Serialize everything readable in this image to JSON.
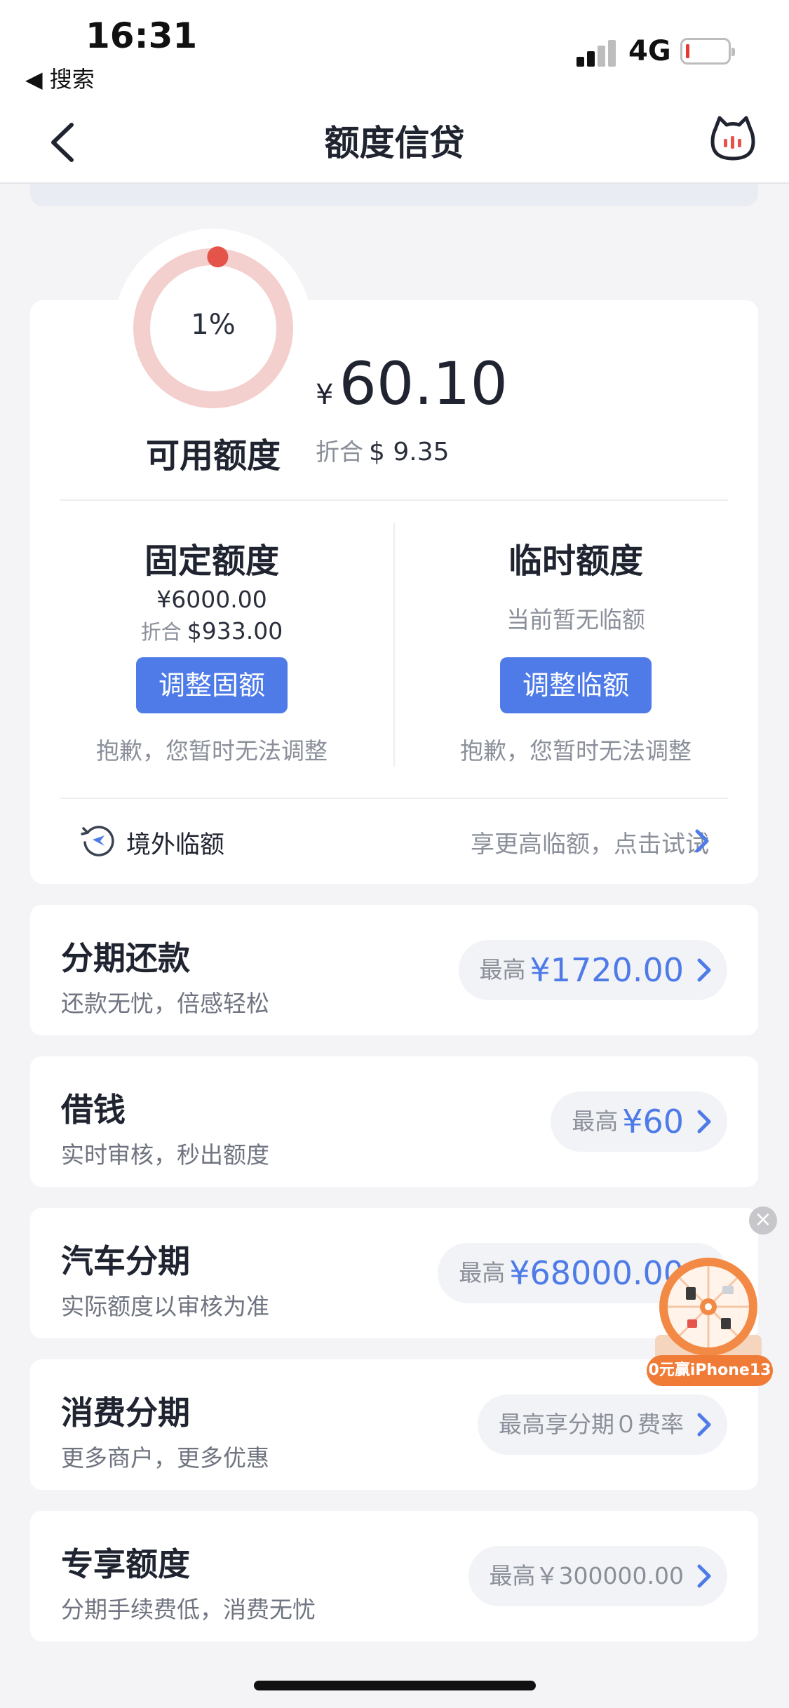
{
  "status_bar": {
    "time": "16:31",
    "back_app": "◀ 搜索",
    "network": "4G"
  },
  "nav": {
    "title": "额度信贷"
  },
  "limit": {
    "percent_text": "1%",
    "percent_value": 1,
    "available_label": "可用额度",
    "currency_symbol": "¥",
    "available_amount": "60.10",
    "usd_prefix": "折合",
    "usd_amount": "$ 9.35",
    "fixed": {
      "title": "固定额度",
      "amount": "¥6000.00",
      "usd_prefix": "折合",
      "usd_amount": "$933.00",
      "button": "调整固额",
      "note": "抱歉，您暂时无法调整"
    },
    "temporary": {
      "title": "临时额度",
      "status": "当前暂无临额",
      "button": "调整临额",
      "note": "抱歉，您暂时无法调整"
    },
    "overseas": {
      "label": "境外临额",
      "hint": "享更高临额，点击试试"
    }
  },
  "products": [
    {
      "title": "分期还款",
      "subtitle": "还款无忧，倍感轻松",
      "prefix": "最高",
      "value": "¥1720.00"
    },
    {
      "title": "借钱",
      "subtitle": "实时审核，秒出额度",
      "prefix": "最高",
      "value": "¥60"
    },
    {
      "title": "汽车分期",
      "subtitle": "实际额度以审核为准",
      "prefix": "最高",
      "value": "¥68000.00"
    },
    {
      "title": "消费分期",
      "subtitle": "更多商户，更多优惠",
      "text": "最高享分期０费率"
    },
    {
      "title": "专享额度",
      "subtitle": "分期手续费低，消费无忧",
      "text": "最高￥300000.00"
    }
  ],
  "promo": {
    "label": "0元赢iPhone13",
    "close": "×"
  },
  "colors": {
    "accent": "#4e7be8",
    "gauge_track": "#f3d0cd",
    "gauge_fill": "#e5544b",
    "promo": "#ef7b36"
  }
}
